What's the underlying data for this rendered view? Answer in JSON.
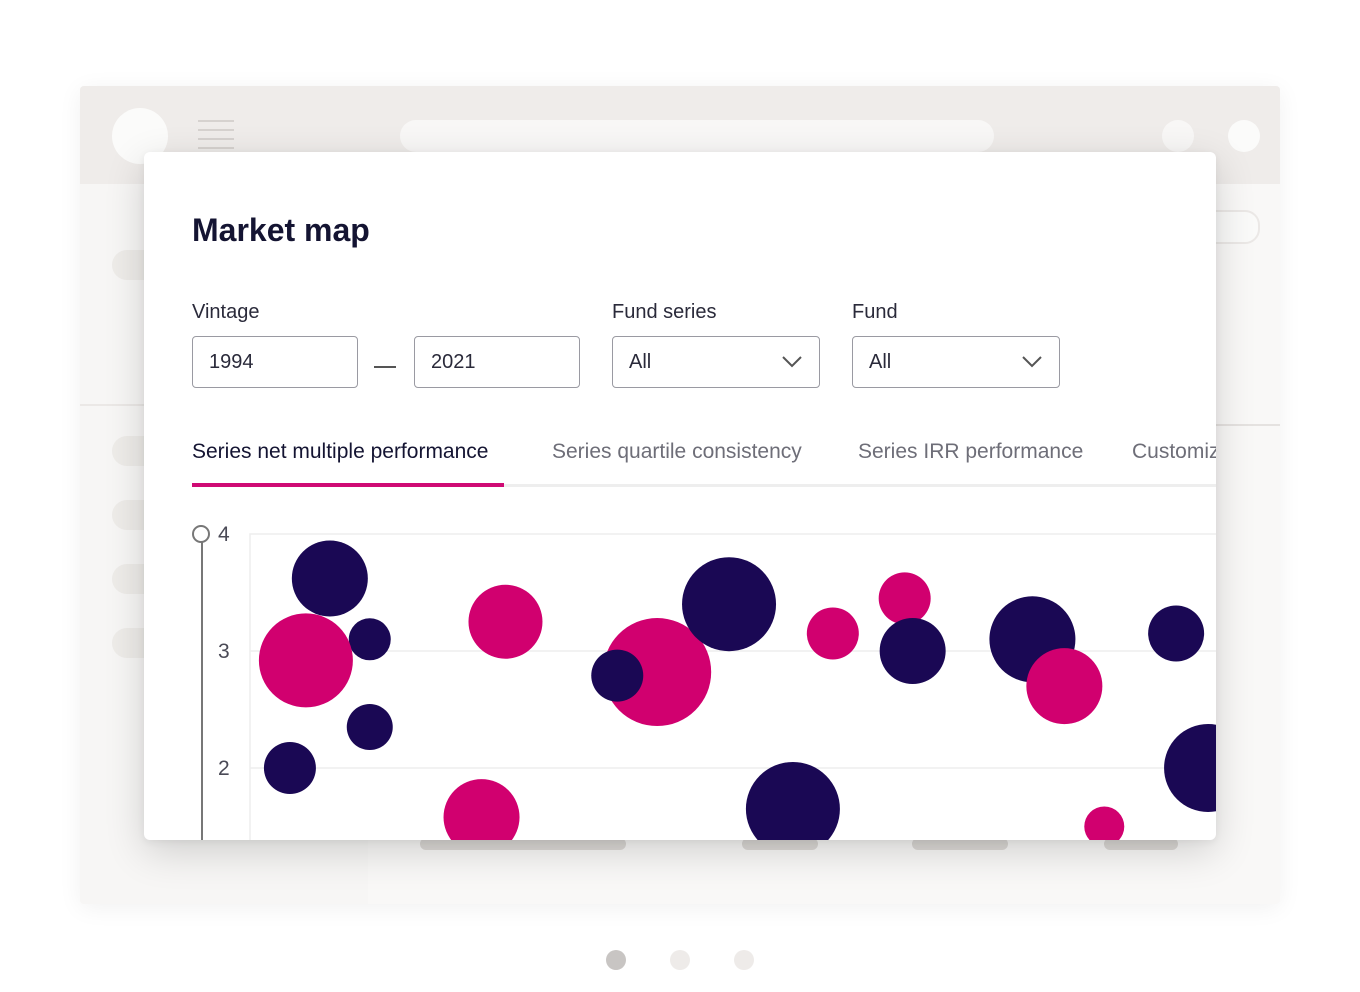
{
  "card": {
    "title": "Market map",
    "filters": {
      "vintage_label": "Vintage",
      "vintage_from": "1994",
      "vintage_to": "2021",
      "fund_series_label": "Fund series",
      "fund_series_value": "All",
      "fund_label": "Fund",
      "fund_value": "All"
    },
    "tabs": [
      {
        "label": "Series net multiple performance",
        "active": true
      },
      {
        "label": "Series quartile consistency",
        "active": false
      },
      {
        "label": "Series IRR performance",
        "active": false
      },
      {
        "label": "Customiz",
        "active": false
      }
    ]
  },
  "chart_data": {
    "type": "scatter",
    "subtype": "bubble",
    "y_ticks": [
      4,
      3,
      2
    ],
    "ylim": [
      1.5,
      4
    ],
    "colors": {
      "navy": "#1a0854",
      "magenta": "#d1006f"
    },
    "bubbles": [
      {
        "x": 1,
        "y": 3.62,
        "r": 38,
        "color": "navy"
      },
      {
        "x": 1.5,
        "y": 3.1,
        "r": 21,
        "color": "navy"
      },
      {
        "x": 0.7,
        "y": 2.92,
        "r": 47,
        "color": "magenta"
      },
      {
        "x": 1.5,
        "y": 2.35,
        "r": 23,
        "color": "navy"
      },
      {
        "x": 0.5,
        "y": 2.0,
        "r": 26,
        "color": "navy"
      },
      {
        "x": 3.2,
        "y": 3.25,
        "r": 37,
        "color": "magenta"
      },
      {
        "x": 2.9,
        "y": 1.58,
        "r": 38,
        "color": "magenta"
      },
      {
        "x": 5.1,
        "y": 2.82,
        "r": 54,
        "color": "magenta"
      },
      {
        "x": 4.6,
        "y": 2.79,
        "r": 26,
        "color": "navy"
      },
      {
        "x": 5.0,
        "y": 2.44,
        "r": 7,
        "color": "magenta"
      },
      {
        "x": 6.0,
        "y": 3.4,
        "r": 47,
        "color": "navy"
      },
      {
        "x": 7.3,
        "y": 3.15,
        "r": 26,
        "color": "magenta"
      },
      {
        "x": 8.2,
        "y": 3.45,
        "r": 26,
        "color": "magenta"
      },
      {
        "x": 8.3,
        "y": 3.0,
        "r": 33,
        "color": "navy"
      },
      {
        "x": 6.8,
        "y": 1.65,
        "r": 47,
        "color": "navy"
      },
      {
        "x": 9.8,
        "y": 3.1,
        "r": 43,
        "color": "navy"
      },
      {
        "x": 10.2,
        "y": 2.7,
        "r": 38,
        "color": "magenta"
      },
      {
        "x": 11.6,
        "y": 3.15,
        "r": 28,
        "color": "navy"
      },
      {
        "x": 12.0,
        "y": 2.0,
        "r": 44,
        "color": "navy"
      },
      {
        "x": 10.7,
        "y": 1.5,
        "r": 20,
        "color": "magenta"
      }
    ]
  },
  "pager": {
    "count": 3,
    "active": 0
  }
}
